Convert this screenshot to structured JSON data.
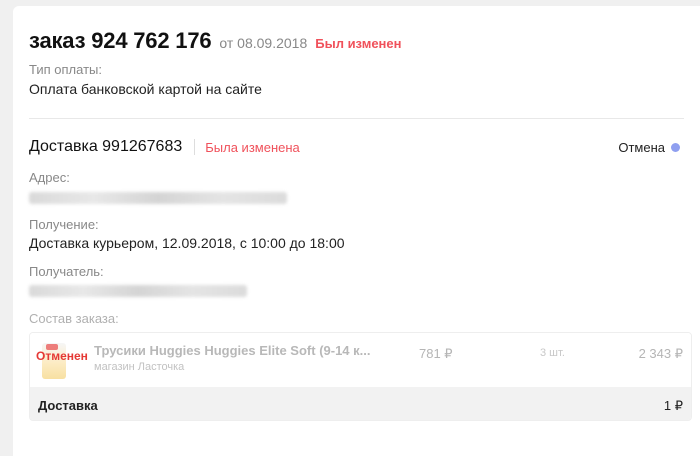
{
  "order": {
    "title": "заказ 924 762 176",
    "date": "от 08.09.2018",
    "changed": "Был изменен"
  },
  "payment": {
    "label": "Тип оплаты:",
    "value": "Оплата банковской картой на сайте"
  },
  "delivery": {
    "title": "Доставка 991267683",
    "changed": "Была изменена",
    "status": "Отмена",
    "status_color": "#8f9ff0",
    "address_label": "Адрес:",
    "receipt_label": "Получение:",
    "receipt_value": "Доставка курьером, 12.09.2018, с 10:00 до 18:00",
    "recipient_label": "Получатель:",
    "composition_label": "Состав заказа:"
  },
  "items": [
    {
      "name": "Трусики Huggies Huggies Elite Soft (9-14 к...",
      "shop": "магазин Ласточка",
      "price": "781 ₽",
      "qty": "3 шт.",
      "total": "2 343 ₽",
      "stamp": "Отменен"
    }
  ],
  "delivery_row": {
    "label": "Доставка",
    "value": "1 ₽"
  },
  "colors": {
    "accent_red": "#f0515b",
    "cancel_red": "#e53935"
  }
}
